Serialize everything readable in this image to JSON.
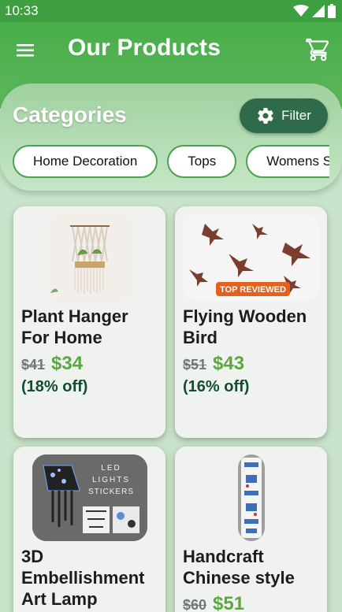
{
  "status_bar": {
    "time": "10:33"
  },
  "app_bar": {
    "title": "Our Products",
    "menu_icon": "menu-icon",
    "cart_icon": "cart-icon"
  },
  "categories": {
    "title": "Categories",
    "filter_label": "Filter",
    "chips": [
      "Home Decoration",
      "Tops",
      "Womens Shoes"
    ]
  },
  "products": [
    {
      "name": "Plant Hanger For Home",
      "old_price": "$41",
      "price": "$34",
      "discount": "(18% off)"
    },
    {
      "name": "Flying Wooden Bird",
      "old_price": "$51",
      "price": "$43",
      "discount": "(16% off)",
      "badge": "TOP REVIEWED"
    },
    {
      "name": "3D Embellishment Art Lamp",
      "image_text": [
        "LED",
        "LIGHTS",
        "STICKERS"
      ]
    },
    {
      "name": "Handcraft Chinese style",
      "old_price": "$60",
      "price": "$51"
    }
  ],
  "colors": {
    "primary": "#48ad48",
    "accent_price": "#5aa83f",
    "filter_bg": "#2f6b4b",
    "discount": "#124d33"
  }
}
